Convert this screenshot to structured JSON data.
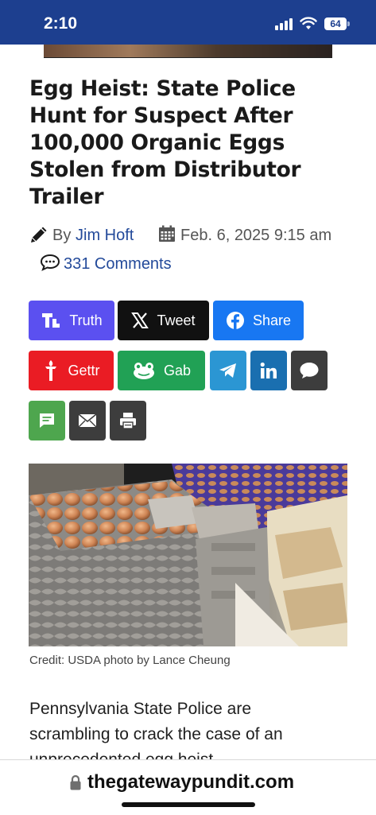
{
  "status_bar": {
    "time": "2:10",
    "battery": "64",
    "icons": [
      "signal-icon",
      "wifi-icon",
      "battery-icon"
    ]
  },
  "article": {
    "headline_lines": [
      "Egg Heist: State Police",
      "Hunt for Suspect After",
      "100,000 Organic Eggs",
      "Stolen from Distributor",
      "Trailer"
    ],
    "by_label": "By",
    "author": "Jim Hoft",
    "date": "Feb. 6, 2025 9:15 am",
    "comments": "331 Comments",
    "image_caption": "Credit: USDA photo by Lance Cheung",
    "body_lines": [
      "Pennsylvania State Police are",
      "scrambling to crack the case of an",
      "unprecedented egg heist"
    ]
  },
  "share_buttons": {
    "truth": "Truth",
    "tweet": "Tweet",
    "share": "Share",
    "gettr": "Gettr",
    "gab": "Gab"
  },
  "colors": {
    "status_bar": "#1d3f8f",
    "truth": "#5b50f0",
    "tweet": "#111111",
    "facebook": "#1877f2",
    "gettr": "#ea1c24",
    "gab": "#21a155",
    "telegram": "#2b96d3",
    "linkedin": "#1a6fb0",
    "sms": "#3d3d3d",
    "chat_green": "#4ea64e",
    "email": "#3d3d3d",
    "print": "#3d3d3d",
    "link": "#234a9a"
  },
  "browser": {
    "url": "thegatewaypundit.com"
  }
}
